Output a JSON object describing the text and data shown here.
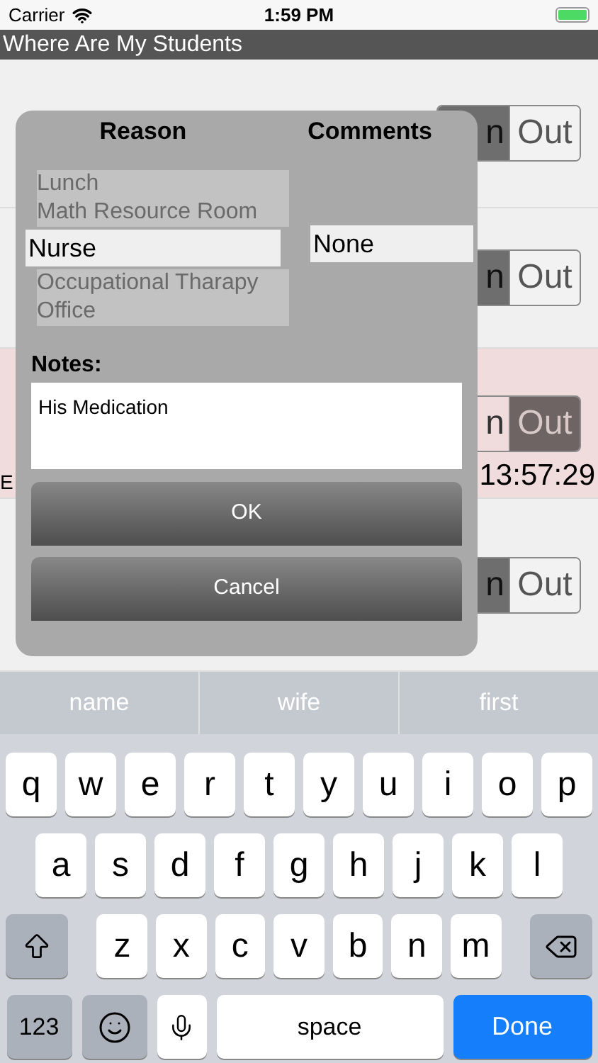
{
  "status_bar": {
    "carrier": "Carrier",
    "time": "1:59 PM"
  },
  "window": {
    "title": "Where Are My Students"
  },
  "rows": [
    {
      "segments": [
        {
          "label": "n",
          "selected": true
        },
        {
          "label": "Out",
          "selected": false
        }
      ],
      "highlighted": false
    },
    {
      "segments": [
        {
          "label": "n",
          "selected": true
        },
        {
          "label": "Out",
          "selected": false
        }
      ],
      "highlighted": false
    },
    {
      "segments": [
        {
          "label": "n",
          "selected": false
        },
        {
          "label": "Out",
          "selected": true
        }
      ],
      "highlighted": true,
      "name": "E",
      "time": "13:57:29"
    },
    {
      "segments": [
        {
          "label": "n",
          "selected": true
        },
        {
          "label": "Out",
          "selected": false
        }
      ],
      "highlighted": false
    }
  ],
  "dialog": {
    "columns": [
      "Reason",
      "Comments"
    ],
    "reasons": [
      {
        "label": "Lunch",
        "selected": false
      },
      {
        "label": "Math Resource Room",
        "selected": false
      },
      {
        "label": "Nurse",
        "selected": true
      },
      {
        "label": "Occupational Tharapy",
        "selected": false
      },
      {
        "label": "Office",
        "selected": false
      }
    ],
    "comments": [
      {
        "label": "None",
        "selected": true
      }
    ],
    "notes_label": "Notes:",
    "notes_value": "His Medication",
    "buttons": [
      "OK",
      "Cancel"
    ]
  },
  "suggestions": [
    "name",
    "wife",
    "first"
  ],
  "keyboard": [
    [
      {
        "kind": "letter",
        "label": "q"
      },
      {
        "kind": "letter",
        "label": "w"
      },
      {
        "kind": "letter",
        "label": "e"
      },
      {
        "kind": "letter",
        "label": "r"
      },
      {
        "kind": "letter",
        "label": "t"
      },
      {
        "kind": "letter",
        "label": "y"
      },
      {
        "kind": "letter",
        "label": "u"
      },
      {
        "kind": "letter",
        "label": "i"
      },
      {
        "kind": "letter",
        "label": "o"
      },
      {
        "kind": "letter",
        "label": "p"
      }
    ],
    [
      {
        "kind": "letter",
        "label": "a"
      },
      {
        "kind": "letter",
        "label": "s"
      },
      {
        "kind": "letter",
        "label": "d"
      },
      {
        "kind": "letter",
        "label": "f"
      },
      {
        "kind": "letter",
        "label": "g"
      },
      {
        "kind": "letter",
        "label": "h"
      },
      {
        "kind": "letter",
        "label": "j"
      },
      {
        "kind": "letter",
        "label": "k"
      },
      {
        "kind": "letter",
        "label": "l"
      }
    ],
    [
      {
        "kind": "shift"
      },
      {
        "kind": "letter",
        "label": "z"
      },
      {
        "kind": "letter",
        "label": "x"
      },
      {
        "kind": "letter",
        "label": "c"
      },
      {
        "kind": "letter",
        "label": "v"
      },
      {
        "kind": "letter",
        "label": "b"
      },
      {
        "kind": "letter",
        "label": "n"
      },
      {
        "kind": "letter",
        "label": "m"
      },
      {
        "kind": "delete"
      }
    ],
    [
      {
        "kind": "numbers",
        "label": "123"
      },
      {
        "kind": "emoji"
      },
      {
        "kind": "mic"
      },
      {
        "kind": "space",
        "label": "space"
      },
      {
        "kind": "done",
        "label": "Done"
      }
    ]
  ]
}
